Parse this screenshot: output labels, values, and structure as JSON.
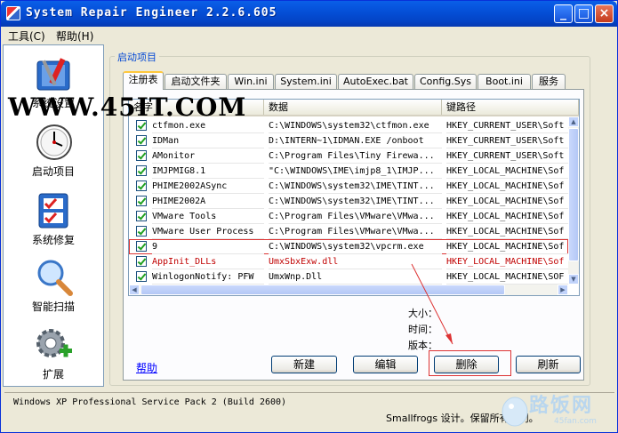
{
  "window": {
    "title": "System Repair Engineer 2.2.6.605"
  },
  "menu": [
    "工具(C)",
    "帮助(H)"
  ],
  "sidebar": {
    "items": [
      {
        "label": "系统设置",
        "icon": "toolbox-icon"
      },
      {
        "label": "启动项目",
        "icon": "clock-icon"
      },
      {
        "label": "系统修复",
        "icon": "checklist-icon"
      },
      {
        "label": "智能扫描",
        "icon": "magnifier-icon"
      },
      {
        "label": "扩展",
        "icon": "gear-plus-icon"
      }
    ],
    "first_label_partial": "SREng"
  },
  "watermark": "WWW.45IT.COM",
  "group_title": "启动项目",
  "tabs": [
    "注册表",
    "启动文件夹",
    "Win.ini",
    "System.ini",
    "AutoExec.bat",
    "Config.Sys",
    "Boot.ini",
    "服务"
  ],
  "active_tab": "注册表",
  "list": {
    "columns": [
      "名字",
      "数据",
      "键路径"
    ],
    "rows": [
      {
        "name": "ctfmon.exe",
        "data": "C:\\WINDOWS\\system32\\ctfmon.exe",
        "path": "HKEY_CURRENT_USER\\Soft",
        "red": false
      },
      {
        "name": "IDMan",
        "data": "D:\\INTERN~1\\IDMAN.EXE /onboot",
        "path": "HKEY_CURRENT_USER\\Soft",
        "red": false
      },
      {
        "name": "AMonitor",
        "data": "C:\\Program Files\\Tiny Firewa...",
        "path": "HKEY_CURRENT_USER\\Soft",
        "red": false
      },
      {
        "name": "IMJPMIG8.1",
        "data": "\"C:\\WINDOWS\\IME\\imjp8_1\\IMJP...",
        "path": "HKEY_LOCAL_MACHINE\\Sof",
        "red": false
      },
      {
        "name": "PHIME2002ASync",
        "data": "C:\\WINDOWS\\system32\\IME\\TINT...",
        "path": "HKEY_LOCAL_MACHINE\\Sof",
        "red": false
      },
      {
        "name": "PHIME2002A",
        "data": "C:\\WINDOWS\\system32\\IME\\TINT...",
        "path": "HKEY_LOCAL_MACHINE\\Sof",
        "red": false
      },
      {
        "name": "VMware Tools",
        "data": "C:\\Program Files\\VMware\\VMwa...",
        "path": "HKEY_LOCAL_MACHINE\\Sof",
        "red": false
      },
      {
        "name": "VMware User Process",
        "data": "C:\\Program Files\\VMware\\VMwa...",
        "path": "HKEY_LOCAL_MACHINE\\Sof",
        "red": false
      },
      {
        "name": "9",
        "data": "C:\\WINDOWS\\system32\\vpcrm.exe",
        "path": "HKEY_LOCAL_MACHINE\\Sof",
        "red": false
      },
      {
        "name": "AppInit_DLLs",
        "data": "UmxSbxExw.dll",
        "path": "HKEY_LOCAL_MACHINE\\Sof",
        "red": true
      },
      {
        "name": "WinlogonNotify: PFW",
        "data": "UmxWnp.Dll",
        "path": "HKEY_LOCAL_MACHINE\\SOF",
        "red": false
      }
    ]
  },
  "info": {
    "size_label": "大小：",
    "time_label": "时间：",
    "version_label": "版本："
  },
  "buttons": {
    "help": "帮助",
    "new": "新建",
    "edit": "编辑",
    "delete": "删除",
    "refresh": "刷新"
  },
  "status": {
    "os": "Windows XP Professional Service Pack 2 (Build 2600)",
    "copyright": "Smallfrogs 设计。保留所有权利。"
  },
  "logo": {
    "name": "路饭网",
    "url": "45fan.com"
  },
  "colors": {
    "title_bar": "#0550d8",
    "highlight": "#dd3333",
    "link": "#0000ff",
    "check": "#21a121"
  }
}
